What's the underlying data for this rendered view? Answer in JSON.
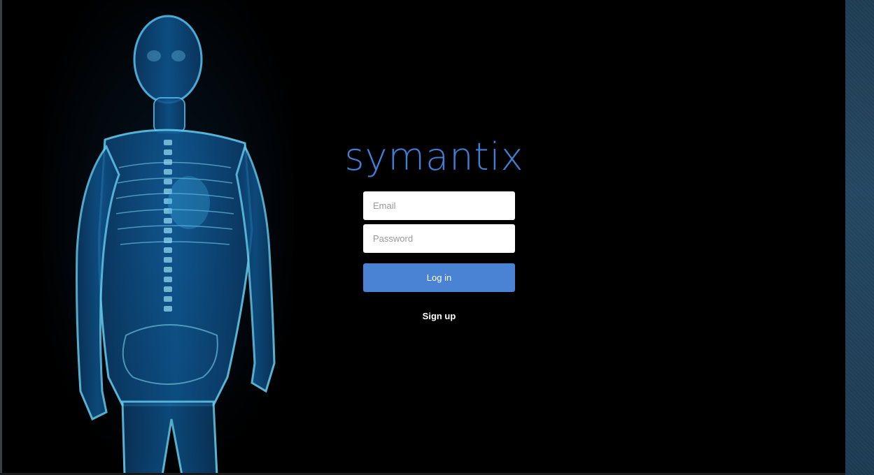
{
  "brand": {
    "logo_text": "symantix",
    "accent_color": "#4a82d4"
  },
  "login_form": {
    "email_placeholder": "Email",
    "password_placeholder": "Password",
    "login_label": "Log in",
    "signup_label": "Sign up"
  },
  "background": {
    "image": "xray-human-body-illustration"
  }
}
